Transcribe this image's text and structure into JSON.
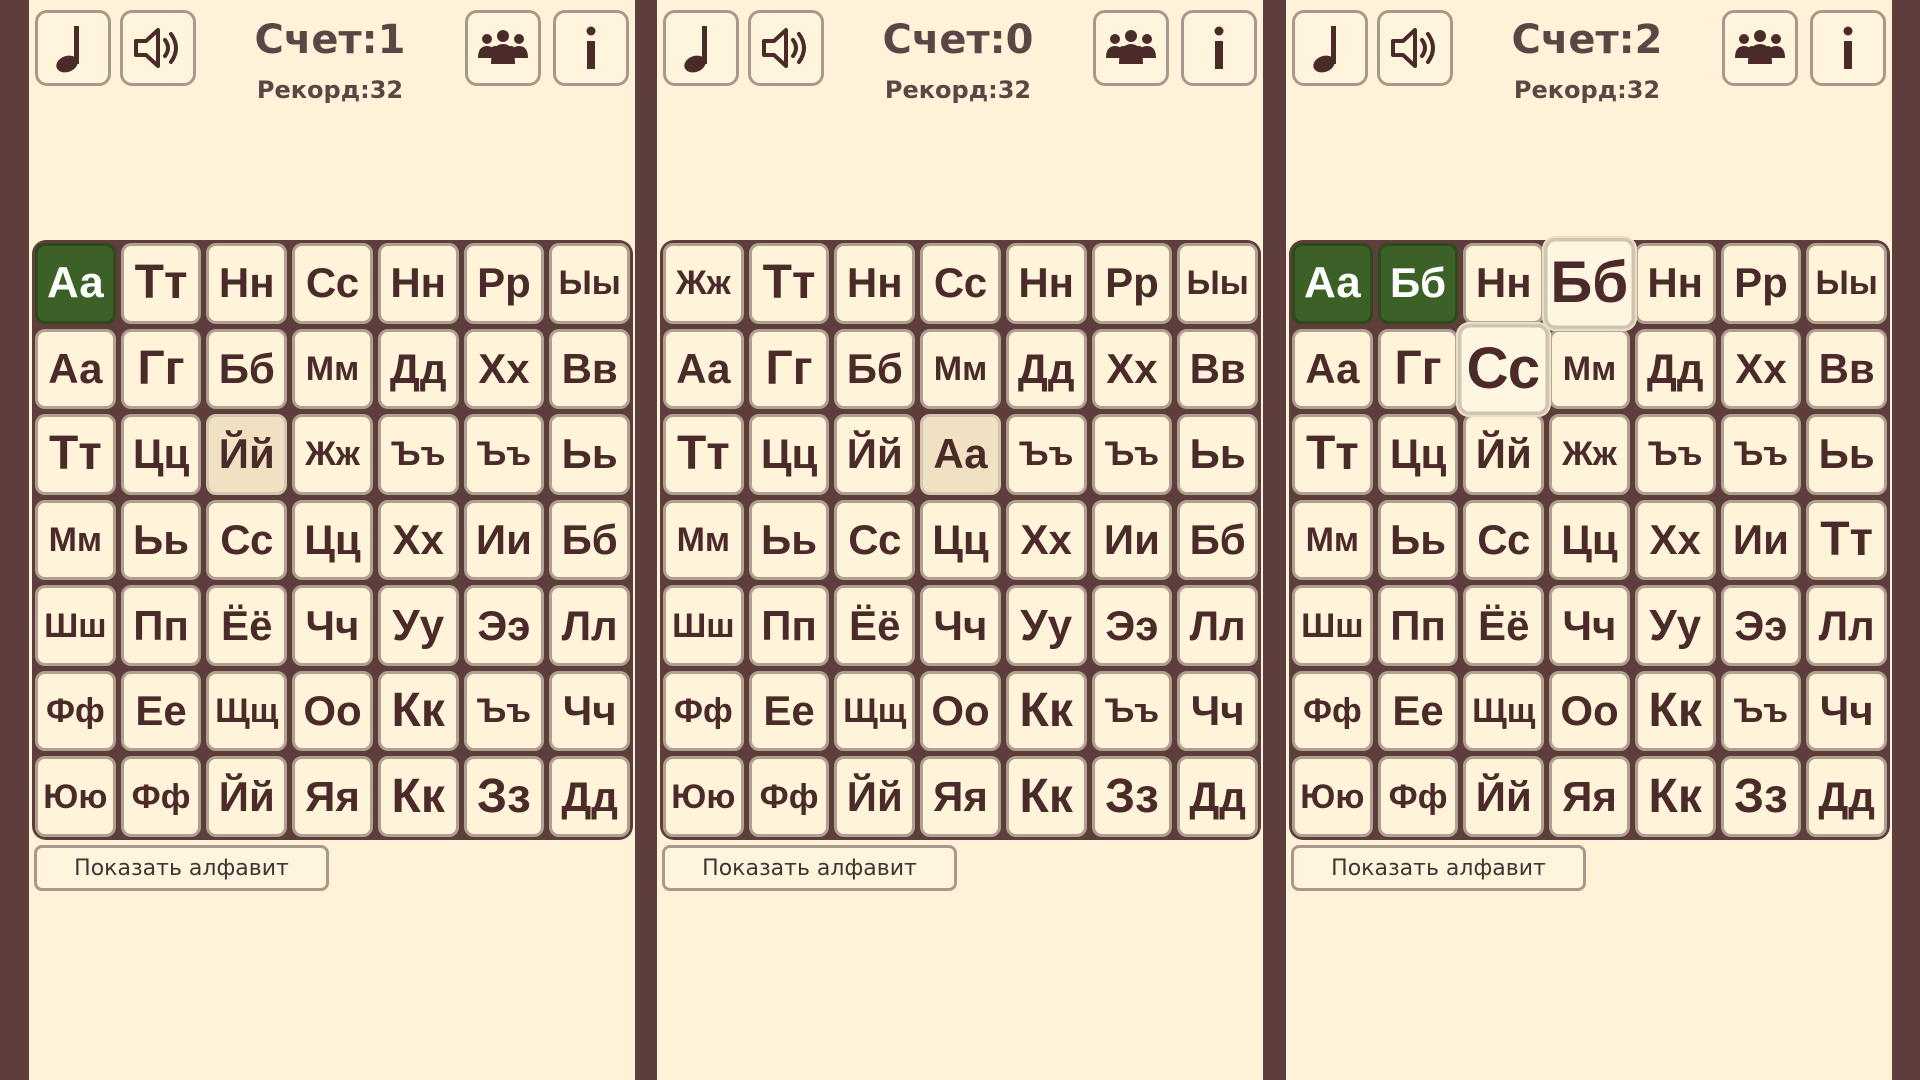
{
  "colors": {
    "frame": "#5e3d3d",
    "panel_bg": "#fff2d8",
    "tile_bg": "#fff4da",
    "correct": "#3c6126",
    "text": "#4b2a2a"
  },
  "icons": {
    "music": "music-note-icon",
    "sound": "speaker-icon",
    "people": "group-icon",
    "info": "info-icon"
  },
  "panels": [
    {
      "score": "Счет:1",
      "record": "Рекорд:32",
      "show_alphabet": "Показать алфавит",
      "grid": [
        [
          "Аа",
          "Тт",
          "Нн",
          "Сс",
          "Нн",
          "Рр",
          "Ыы"
        ],
        [
          "Аа",
          "Гг",
          "Бб",
          "Мм",
          "Дд",
          "Хх",
          "Вв"
        ],
        [
          "Тт",
          "Цц",
          "Йй",
          "Жж",
          "Ъъ",
          "Ъъ",
          "Ьь"
        ],
        [
          "Мм",
          "Ьь",
          "Сс",
          "Цц",
          "Хх",
          "Ии",
          "Бб"
        ],
        [
          "Шш",
          "Пп",
          "Ёё",
          "Чч",
          "Уу",
          "Ээ",
          "Лл"
        ],
        [
          "Фф",
          "Ее",
          "Щщ",
          "Оо",
          "Кк",
          "Ъъ",
          "Чч"
        ],
        [
          "Юю",
          "Фф",
          "Йй",
          "Яя",
          "Кк",
          "Зз",
          "Дд"
        ]
      ]
    },
    {
      "score": "Счет:0",
      "record": "Рекорд:32",
      "show_alphabet": "Показать алфавит",
      "grid": [
        [
          "Жж",
          "Тт",
          "Нн",
          "Сс",
          "Нн",
          "Рр",
          "Ыы"
        ],
        [
          "Аа",
          "Гг",
          "Бб",
          "Мм",
          "Дд",
          "Хх",
          "Вв"
        ],
        [
          "Тт",
          "Цц",
          "Йй",
          "Аа",
          "Ъъ",
          "Ъъ",
          "Ьь"
        ],
        [
          "Мм",
          "Ьь",
          "Сс",
          "Цц",
          "Хх",
          "Ии",
          "Бб"
        ],
        [
          "Шш",
          "Пп",
          "Ёё",
          "Чч",
          "Уу",
          "Ээ",
          "Лл"
        ],
        [
          "Фф",
          "Ее",
          "Щщ",
          "Оо",
          "Кк",
          "Ъъ",
          "Чч"
        ],
        [
          "Юю",
          "Фф",
          "Йй",
          "Яя",
          "Кк",
          "Зз",
          "Дд"
        ]
      ]
    },
    {
      "score": "Счет:2",
      "record": "Рекорд:32",
      "show_alphabet": "Показать алфавит",
      "grid": [
        [
          "Аа",
          "Бб",
          "Нн",
          "Бб",
          "Нн",
          "Рр",
          "Ыы"
        ],
        [
          "Аа",
          "Гг",
          "Сс",
          "Мм",
          "Дд",
          "Хх",
          "Вв"
        ],
        [
          "Тт",
          "Цц",
          "Йй",
          "Жж",
          "Ъъ",
          "Ъъ",
          "Ьь"
        ],
        [
          "Мм",
          "Ьь",
          "Сс",
          "Цц",
          "Хх",
          "Ии",
          "Тт"
        ],
        [
          "Шш",
          "Пп",
          "Ёё",
          "Чч",
          "Уу",
          "Ээ",
          "Лл"
        ],
        [
          "Фф",
          "Ее",
          "Щщ",
          "Оо",
          "Кк",
          "Ъъ",
          "Чч"
        ],
        [
          "Юю",
          "Фф",
          "Йй",
          "Яя",
          "Кк",
          "Зз",
          "Дд"
        ]
      ]
    }
  ]
}
